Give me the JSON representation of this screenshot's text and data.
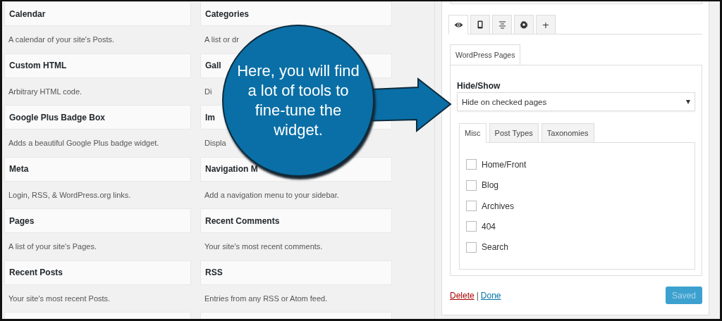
{
  "widgets": {
    "columns": [
      [
        {
          "title": "Calendar",
          "description": "A calendar of your site's Posts."
        },
        {
          "title": "Custom HTML",
          "description": "Arbitrary HTML code."
        },
        {
          "title": "Google Plus Badge Box",
          "description": "Adds a beautiful Google Plus badge widget."
        },
        {
          "title": "Meta",
          "description": "Login, RSS, & WordPress.org links."
        },
        {
          "title": "Pages",
          "description": "A list of your site's Pages."
        },
        {
          "title": "Recent Posts",
          "description": "Your site's most recent Posts."
        }
      ],
      [
        {
          "title": "Categories",
          "description": "A list or dr"
        },
        {
          "title": "Gall",
          "description": "Di"
        },
        {
          "title": "Im",
          "description": "Displa"
        },
        {
          "title": "Navigation M",
          "description": "Add a navigation menu to your sidebar."
        },
        {
          "title": "Recent Comments",
          "description": "Your site's most recent comments."
        },
        {
          "title": "RSS",
          "description": "Entries from any RSS or Atom feed."
        }
      ]
    ]
  },
  "callout": {
    "text": "Here, you will find a lot of tools to fine-tune the widget."
  },
  "panel": {
    "icon_tabs": [
      {
        "kind": "eye",
        "selected": true
      },
      {
        "kind": "mobile",
        "selected": false
      },
      {
        "kind": "align",
        "selected": false
      },
      {
        "kind": "gear",
        "selected": false
      },
      {
        "kind": "plus",
        "label": "+",
        "selected": false
      }
    ],
    "section_tab": {
      "label": "WordPress Pages",
      "selected": true
    },
    "hide_show": {
      "label": "Hide/Show",
      "value": "Hide on checked pages"
    },
    "sub_tabs": [
      {
        "label": "Misc",
        "selected": true
      },
      {
        "label": "Post Types",
        "selected": false
      },
      {
        "label": "Taxonomies",
        "selected": false
      }
    ],
    "checkboxes": [
      {
        "label": "Home/Front",
        "checked": false
      },
      {
        "label": "Blog",
        "checked": false
      },
      {
        "label": "Archives",
        "checked": false
      },
      {
        "label": "404",
        "checked": false
      },
      {
        "label": "Search",
        "checked": false
      }
    ],
    "footer": {
      "delete": "Delete",
      "separator": "|",
      "done": "Done",
      "save": {
        "label": "Saved",
        "disabled": true
      }
    }
  }
}
